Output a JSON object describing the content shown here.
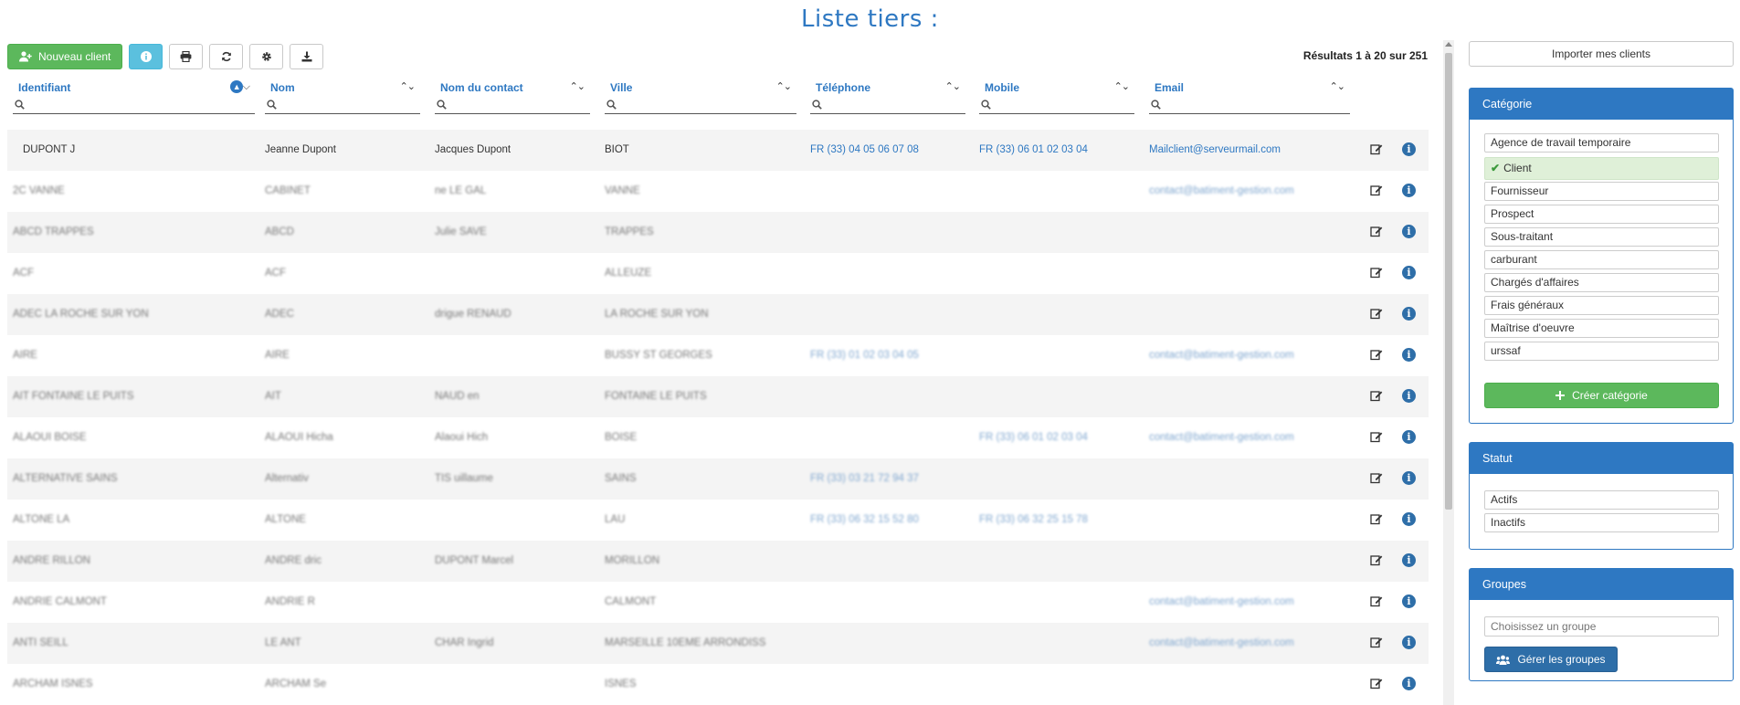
{
  "page": {
    "title": "Liste tiers :"
  },
  "toolbar": {
    "new_client_label": "Nouveau client",
    "results_text": "Résultats 1 à 20 sur 251",
    "icons": [
      "user-plus-icon",
      "info-icon",
      "print-icon",
      "refresh-icon",
      "gear-icon",
      "download-icon"
    ]
  },
  "table": {
    "columns": [
      {
        "label": "Identifiant",
        "sort": "active"
      },
      {
        "label": "Nom",
        "sort": "none"
      },
      {
        "label": "Nom du contact",
        "sort": "none"
      },
      {
        "label": "Ville",
        "sort": "none"
      },
      {
        "label": "Téléphone",
        "sort": "none"
      },
      {
        "label": "Mobile",
        "sort": "none"
      },
      {
        "label": "Email",
        "sort": "none"
      }
    ],
    "rows": [
      {
        "blurred": false,
        "identifiant": "DUPONT J",
        "nom": "Jeanne Dupont",
        "contact": "Jacques Dupont",
        "ville": "BIOT",
        "telephone": "FR (33) 04 05 06 07 08",
        "mobile": "FR (33) 06 01 02 03 04",
        "email": "Mailclient@serveurmail.com"
      },
      {
        "blurred": true,
        "identifiant": "2C     VANNE",
        "nom": "CABINET",
        "contact": "     ne LE GAL",
        "ville": "VANNE",
        "telephone": "",
        "mobile": "",
        "email": "contact@batiment-gestion.com"
      },
      {
        "blurred": true,
        "identifiant": "ABCD TRAPPES",
        "nom": "ABCD",
        "contact": "Julie SAVE",
        "ville": "TRAPPES",
        "telephone": "",
        "mobile": "",
        "email": ""
      },
      {
        "blurred": true,
        "identifiant": "ACF",
        "nom": "ACF",
        "contact": "",
        "ville": "ALLEUZE",
        "telephone": "",
        "mobile": "",
        "email": ""
      },
      {
        "blurred": true,
        "identifiant": "ADEC    LA ROCHE SUR YON",
        "nom": "ADEC",
        "contact": "     drigue RENAUD",
        "ville": "LA ROCHE SUR YON",
        "telephone": "",
        "mobile": "",
        "email": ""
      },
      {
        "blurred": true,
        "identifiant": "AIRE",
        "nom": "AIRE",
        "contact": "",
        "ville": "BUSSY ST GEORGES",
        "telephone": "FR (33) 01 02 03 04 05",
        "mobile": "",
        "email": "contact@batiment-gestion.com"
      },
      {
        "blurred": true,
        "identifiant": "AIT   FONTAINE LE PUITS",
        "nom": "AIT",
        "contact": "      NAUD en",
        "ville": "FONTAINE LE PUITS",
        "telephone": "",
        "mobile": "",
        "email": ""
      },
      {
        "blurred": true,
        "identifiant": "ALAOUI BOISE",
        "nom": "ALAOUI Hicha",
        "contact": "Alaoui Hich",
        "ville": "BOISE",
        "telephone": "",
        "mobile": "FR (33) 06 01 02 03 04",
        "email": "contact@batiment-gestion.com"
      },
      {
        "blurred": true,
        "identifiant": "ALTERNATIVE SAINS",
        "nom": "Alternativ",
        "contact": "TIS     uillaume",
        "ville": "SAINS",
        "telephone": "FR (33) 03 21 72 94 37",
        "mobile": "",
        "email": ""
      },
      {
        "blurred": true,
        "identifiant": "ALTONE    LA",
        "nom": "ALTONE",
        "contact": "",
        "ville": "LAU",
        "telephone": "FR (33) 06 32 15 52 80",
        "mobile": "FR (33) 06 32 25 15 78",
        "email": ""
      },
      {
        "blurred": true,
        "identifiant": "ANDRE        RILLON",
        "nom": "ANDRE       dric",
        "contact": "DUPONT Marcel",
        "ville": "MORILLON",
        "telephone": "",
        "mobile": "",
        "email": ""
      },
      {
        "blurred": true,
        "identifiant": "ANDRIE   CALMONT",
        "nom": "ANDRIE   R",
        "contact": "",
        "ville": "CALMONT",
        "telephone": "",
        "mobile": "",
        "email": "contact@batiment-gestion.com"
      },
      {
        "blurred": true,
        "identifiant": "ANTI       SEILL",
        "nom": "LE ANT",
        "contact": "CHAR      Ingrid",
        "ville": "MARSEILLE 10EME ARRONDISS",
        "telephone": "",
        "mobile": "",
        "email": "contact@batiment-gestion.com"
      },
      {
        "blurred": true,
        "identifiant": "ARCHAM        ISNES",
        "nom": "ARCHAM      Se",
        "contact": "",
        "ville": "ISNES",
        "telephone": "",
        "mobile": "",
        "email": ""
      }
    ]
  },
  "sidebar": {
    "import_label": "Importer mes clients",
    "categorie": {
      "title": "Catégorie",
      "items": [
        {
          "label": "Agence de travail temporaire",
          "active": false
        },
        {
          "label": "Client",
          "active": true
        },
        {
          "label": "Fournisseur",
          "active": false
        },
        {
          "label": "Prospect",
          "active": false
        },
        {
          "label": "Sous-traitant",
          "active": false
        },
        {
          "label": "carburant",
          "active": false
        },
        {
          "label": "Chargés d'affaires",
          "active": false
        },
        {
          "label": "Frais généraux",
          "active": false
        },
        {
          "label": "Maîtrise d'oeuvre",
          "active": false
        },
        {
          "label": "urssaf",
          "active": false
        }
      ],
      "create_label": "Créer catégorie"
    },
    "statut": {
      "title": "Statut",
      "items": [
        {
          "label": "Actifs"
        },
        {
          "label": "Inactifs"
        }
      ]
    },
    "groupes": {
      "title": "Groupes",
      "placeholder": "Choisissez un groupe",
      "manage_label": "Gérer les groupes"
    }
  },
  "colors": {
    "accent": "#2e78c2",
    "success": "#5cb85c",
    "info": "#5bc0de",
    "zebra": "#f4f4f4"
  }
}
